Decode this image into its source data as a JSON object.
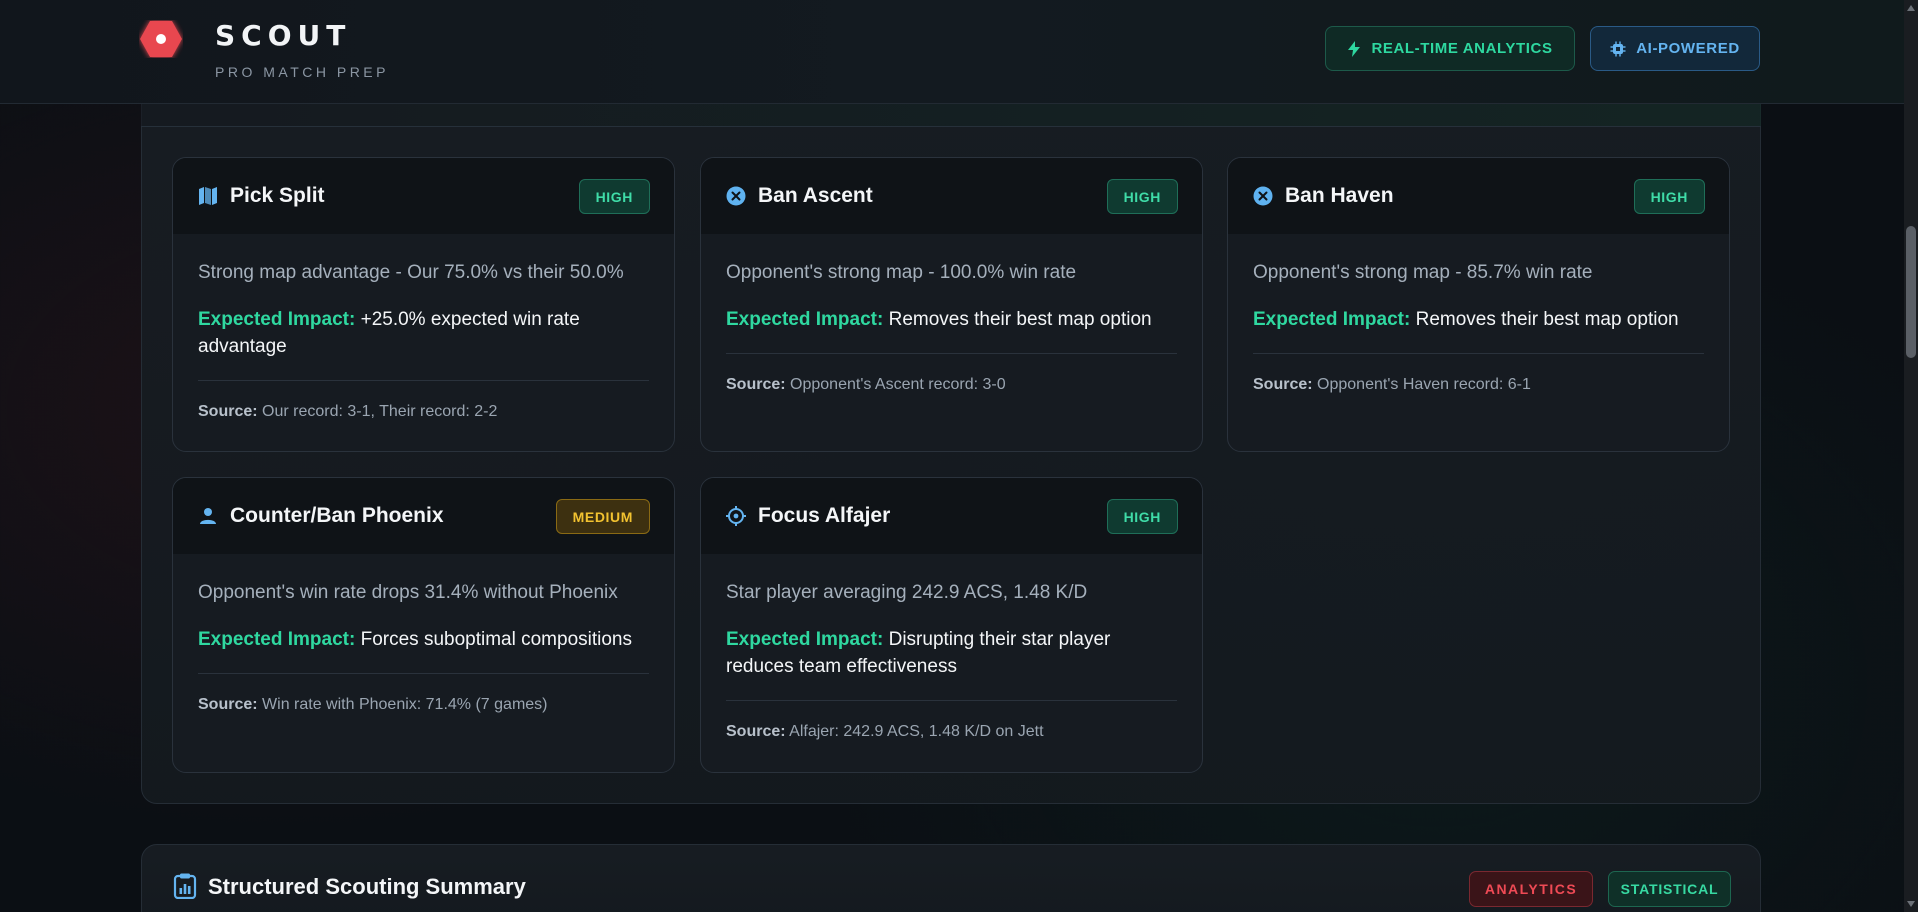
{
  "header": {
    "brand_title": "SCOUT",
    "brand_subtitle": "PRO MATCH PREP",
    "badges": [
      {
        "label": "REAL-TIME ANALYTICS",
        "icon": "lightning-icon",
        "color": "#2ed8a0"
      },
      {
        "label": "AI-POWERED",
        "icon": "chip-icon",
        "color": "#64b4f0"
      }
    ]
  },
  "recommendations": [
    {
      "title": "Pick Split",
      "icon": "map-icon",
      "priority": "HIGH",
      "description": "Strong map advantage - Our 75.0% vs their 50.0%",
      "impact_label": "Expected Impact:",
      "impact_text": "+25.0% expected win rate advantage",
      "source_label": "Source:",
      "source_text": "Our record: 3-1, Their record: 2-2"
    },
    {
      "title": "Ban Ascent",
      "icon": "x-circle-icon",
      "priority": "HIGH",
      "description": "Opponent's strong map - 100.0% win rate",
      "impact_label": "Expected Impact:",
      "impact_text": "Removes their best map option",
      "source_label": "Source:",
      "source_text": "Opponent's Ascent record: 3-0"
    },
    {
      "title": "Ban Haven",
      "icon": "x-circle-icon",
      "priority": "HIGH",
      "description": "Opponent's strong map - 85.7% win rate",
      "impact_label": "Expected Impact:",
      "impact_text": "Removes their best map option",
      "source_label": "Source:",
      "source_text": "Opponent's Haven record: 6-1"
    },
    {
      "title": "Counter/Ban Phoenix",
      "icon": "user-icon",
      "priority": "MEDIUM",
      "description": "Opponent's win rate drops 31.4% without Phoenix",
      "impact_label": "Expected Impact:",
      "impact_text": "Forces suboptimal compositions",
      "source_label": "Source:",
      "source_text": "Win rate with Phoenix: 71.4% (7 games)"
    },
    {
      "title": "Focus Alfajer",
      "icon": "crosshair-icon",
      "priority": "HIGH",
      "description": "Star player averaging 242.9 ACS, 1.48 K/D",
      "impact_label": "Expected Impact:",
      "impact_text": "Disrupting their star player reduces team effectiveness",
      "source_label": "Source:",
      "source_text": "Alfajer: 242.9 ACS, 1.48 K/D on Jett"
    }
  ],
  "summary": {
    "title": "Structured Scouting Summary",
    "icon": "clipboard-chart-icon",
    "badges": [
      {
        "label": "ANALYTICS",
        "color": "#ef4a55"
      },
      {
        "label": "STATISTICAL",
        "color": "#37d9a2"
      }
    ]
  },
  "colors": {
    "accent_green": "#2fd8a0",
    "accent_blue": "#64b4f0",
    "accent_red": "#e8464f",
    "priority_medium": "#f2c230"
  }
}
